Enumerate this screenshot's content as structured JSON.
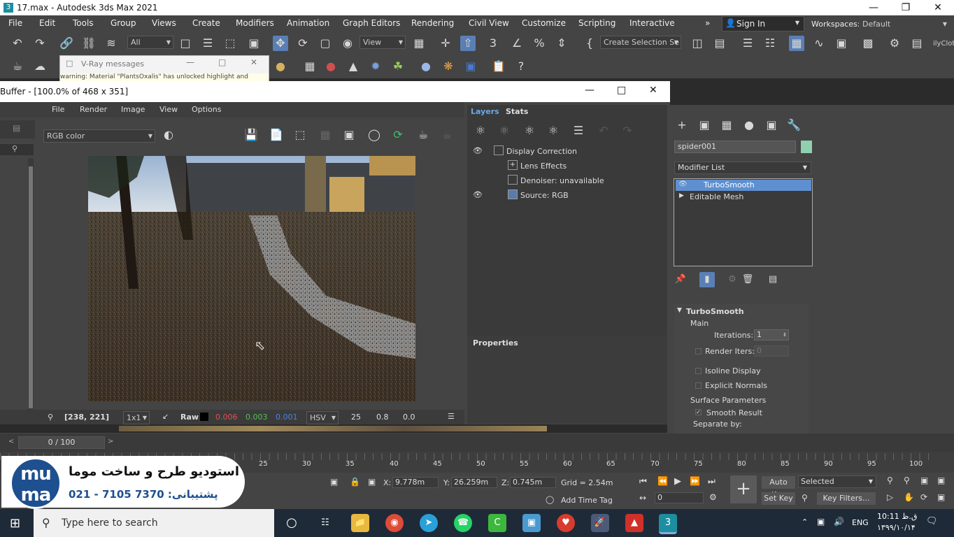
{
  "title_bar": {
    "title": "17.max - Autodesk 3ds Max 2021"
  },
  "menu": [
    "File",
    "Edit",
    "Tools",
    "Group",
    "Views",
    "Create",
    "Modifiers",
    "Animation",
    "Graph Editors",
    "Rendering",
    "Civil View",
    "Customize",
    "Scripting",
    "Interactive"
  ],
  "sign_in": "Sign In",
  "workspaces": {
    "label": "Workspaces:",
    "value": "Default"
  },
  "toolbar": {
    "selection_filter": "All",
    "ref_coord": "View",
    "selection_set": "Create Selection Se",
    "extra": "ilyClot"
  },
  "vray_messages": {
    "title": "V-Ray messages",
    "line": "warning: Material \"PlantsOxalis\" has unlocked highlight and"
  },
  "vfb": {
    "title": "Buffer - [100.0% of 468 x 351]",
    "menu": [
      "File",
      "Render",
      "Image",
      "View",
      "Options"
    ],
    "channel": "RGB color",
    "status": {
      "coords": "[238, 221]",
      "zoom": "1x1",
      "mode": "Raw",
      "r": "0.006",
      "g": "0.003",
      "b": "0.001",
      "colorspace": "HSV",
      "h": "25",
      "s": "0.8",
      "v": "0.0"
    },
    "tabs": [
      "Layers",
      "Stats"
    ],
    "layers": [
      "Display Correction",
      "Lens Effects",
      "Denoiser: unavailable",
      "Source: RGB"
    ],
    "properties_label": "Properties"
  },
  "command_panel": {
    "object_name": "spider001",
    "object_color": "#8fd0b0",
    "modifier_list": "Modifier List",
    "stack": [
      "TurboSmooth",
      "Editable Mesh"
    ],
    "rollout": {
      "title": "TurboSmooth",
      "main": "Main",
      "iterations_label": "Iterations:",
      "iterations_value": "1",
      "render_iters_label": "Render Iters:",
      "render_iters_value": "0",
      "isoline": "Isoline Display",
      "explicit": "Explicit Normals",
      "surface": "Surface Parameters",
      "smooth": "Smooth Result",
      "separate": "Separate by:"
    }
  },
  "timeline": {
    "frame": "0 / 100",
    "ticks": [
      "25",
      "30",
      "35",
      "40",
      "45",
      "50",
      "55",
      "60",
      "65",
      "70",
      "75",
      "80",
      "85",
      "90",
      "95",
      "100"
    ]
  },
  "status_bar": {
    "x_label": "X:",
    "x": "9.778m",
    "y_label": "Y:",
    "y": "26.259m",
    "z_label": "Z:",
    "z": "0.745m",
    "grid": "Grid = 2.54m",
    "add_time_tag": "Add Time Tag",
    "auto_key": "Auto Key",
    "selected": "Selected",
    "set_key": "Set Key",
    "key_filters": "Key Filters...",
    "frame_field": "0"
  },
  "logo": {
    "brand": "mu ma",
    "line1": "استودیو طرح و ساخت موما",
    "line2": "021 - 7105 7370 :پشتیبانی"
  },
  "taskbar": {
    "search": "Type here to search",
    "lang": "ENG",
    "time": "ق.ظ 10:11",
    "date": "۱۳۹۹/۱۰/۱۴"
  }
}
